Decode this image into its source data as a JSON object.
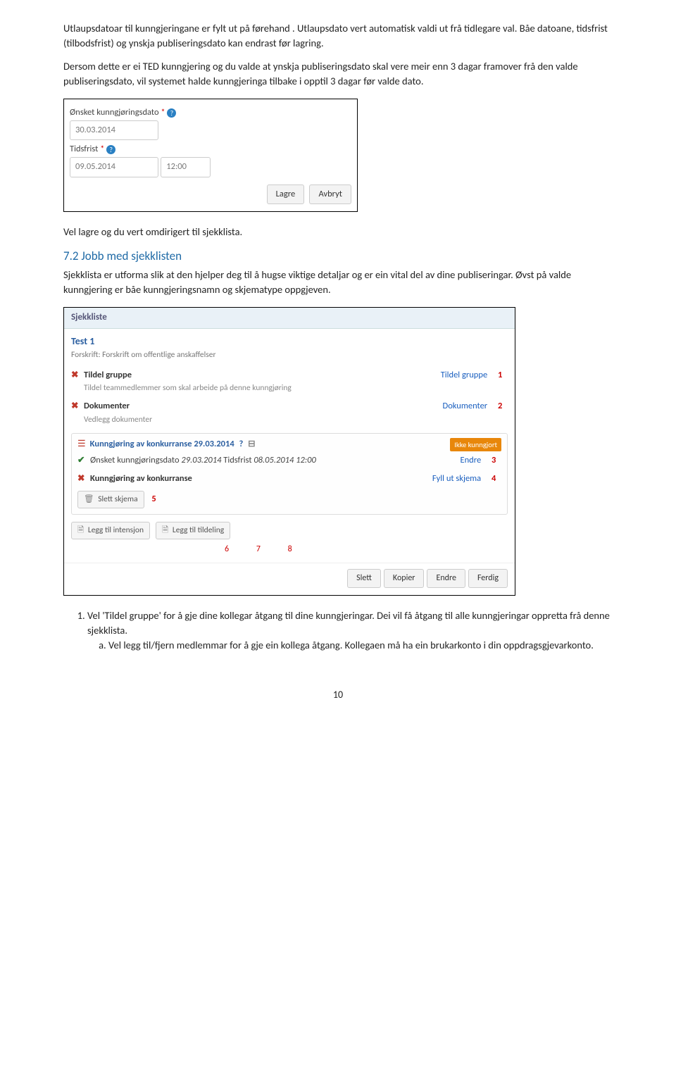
{
  "intro": {
    "p1": "Utlaupsdatoar til kunngjeringane er fylt ut på førehand . Utlaupsdato vert automatisk valdi ut frå tidlegare val.  Båe datoane, tidsfrist (tilbodsfrist) og ynskja publiseringsdato  kan endrast  før lagring.",
    "p2": "Dersom dette er ei TED kunngjering og du valde at ynskja publiseringsdato skal  vere meir enn 3 dagar framover frå den valde publiseringsdato,  vil systemet halde kunngjeringa tilbake i opptil 3 dagar før valde dato."
  },
  "datespanel": {
    "pubdate_label": "Ønsket kunngjøringsdato",
    "pubdate_value": "30.03.2014",
    "deadline_label": "Tidsfrist",
    "deadline_value": "09.05.2014",
    "deadline_time": "12:00",
    "save": "Lagre",
    "cancel": "Avbryt"
  },
  "after_dates": "Vel lagre og du vert omdirigert til sjekklista.",
  "section72": {
    "heading": "7.2 Jobb med sjekklisten",
    "p": "Sjekklista er utforma slik at den hjelper deg til å hugse viktige detaljar og er ein vital del av dine publiseringar. Øvst på valde kunngjering er  båe kunngjeringsnamn og skjematype oppgjeven."
  },
  "checklist": {
    "panel_label": "Sjekkliste",
    "title": "Test 1",
    "subtitle": "Forskrift: Forskrift om offentlige anskaffelser",
    "row_assign_title": "Tildel gruppe",
    "row_assign_sub": "Tildel teammedlemmer som skal arbeide på denne kunngjøring",
    "row_assign_link": "Tildel gruppe",
    "row_assign_num": "1",
    "row_docs_title": "Dokumenter",
    "row_docs_sub": "Vedlegg dokumenter",
    "row_docs_link": "Dokumenter",
    "row_docs_num": "2",
    "ann_title": "Kunngjøring av konkurranse 29.03.2014",
    "ann_badge": "Ikke kunngjort",
    "ann_dates_pre": "Ønsket kunngjøringsdato ",
    "ann_dates_d1": "29.03.2014",
    "ann_dates_mid": " Tidsfrist ",
    "ann_dates_d2": "08.05.2014 12:00",
    "ann_dates_link": "Endre",
    "ann_dates_num": "3",
    "ann_form_title": "Kunngjøring av konkurranse",
    "ann_form_link": "Fyll ut skjema",
    "ann_form_num": "4",
    "delete_schema": "Slett skjema",
    "delete_num": "5",
    "add_intention": "Legg til intensjon",
    "add_award": "Legg til tildeling",
    "n6": "6",
    "n7": "7",
    "n8": "8",
    "bottom_slett": "Slett",
    "bottom_kopier": "Kopier",
    "bottom_endre": "Endre",
    "bottom_ferdig": "Ferdig"
  },
  "list": {
    "i1": "Vel  'Tildel gruppe' for å gje dine kollegar åtgang til dine kunngjeringar. Dei vil få åtgang til alle kunngjeringar oppretta frå denne sjekklista.",
    "i1a": "Vel  legg til/fjern medlemmar for å gje ein kollega åtgang. Kollegaen må ha ein brukarkonto i din oppdragsgjevarkonto."
  },
  "pagenum": "10"
}
